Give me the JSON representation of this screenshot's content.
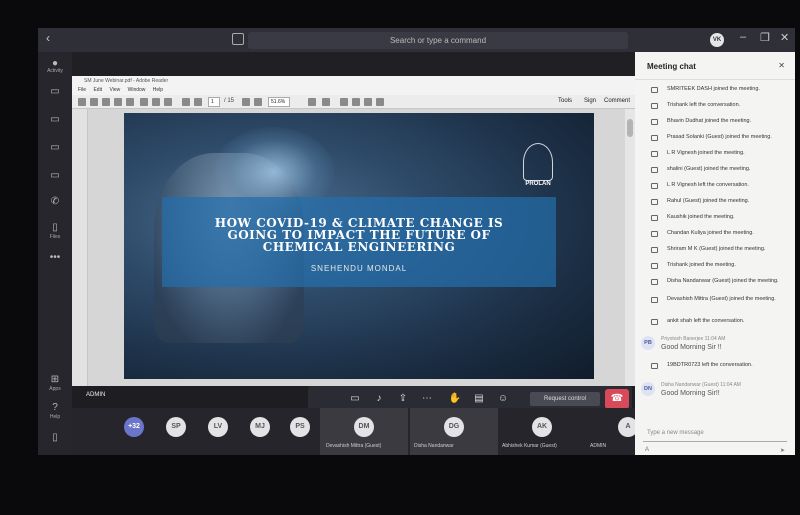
{
  "topbar": {
    "search_placeholder": "Search or type a command",
    "avatar_initials": "VK",
    "min": "–",
    "max": "❐",
    "close": "✕"
  },
  "rail": {
    "activity": "Activity",
    "apps": "Apps",
    "help": "Help",
    "files": "Files",
    "more": "•••"
  },
  "pdf": {
    "window_title": "SM June Webinar.pdf - Adobe Reader",
    "menu": [
      "File",
      "Edit",
      "View",
      "Window",
      "Help"
    ],
    "page_current": "1",
    "page_total": "/ 15",
    "zoom": "51.6%",
    "tools_right": [
      "Tools",
      "Sign",
      "Comment"
    ]
  },
  "slide": {
    "title_line1": "HOW COVID-19 & CLIMATE CHANGE IS",
    "title_line2": "GOING TO IMPACT THE FUTURE OF",
    "title_line3": "CHEMICAL ENGINEERING",
    "author": "SNEHENDU MONDAL",
    "logo_text": "PROLAN"
  },
  "stage": {
    "admin_label": "ADMIN",
    "request_control": "Request control"
  },
  "people": [
    {
      "initials": "+32",
      "name": ""
    },
    {
      "initials": "SP",
      "name": ""
    },
    {
      "initials": "LV",
      "name": ""
    },
    {
      "initials": "MJ",
      "name": ""
    },
    {
      "initials": "PS",
      "name": ""
    },
    {
      "initials": "DM",
      "name": "Devashish Mittra (Guest)"
    },
    {
      "initials": "DG",
      "name": "Disha Nandanwar"
    },
    {
      "initials": "AK",
      "name": "Abhishek Kumar (Guest)"
    },
    {
      "initials": "A",
      "name": "ADMIN"
    }
  ],
  "chat": {
    "title": "Meeting chat",
    "events": [
      "SMRITEEK DASH joined the meeting.",
      "Trishank left the conversation.",
      "Bhavin Dudhat joined the meeting.",
      "Prasad Solanki (Guest) joined the meeting.",
      "L R Vignesh joined the meeting.",
      "shalini (Guest) joined the meeting.",
      "L R Vignesh left the conversation.",
      "Rahul (Guest) joined the meeting.",
      "Kaushik joined the meeting.",
      "Chandan Kuliya joined the meeting.",
      "Shriram M K (Guest) joined the meeting.",
      "Trishank joined the meeting.",
      "Disha Nandanwar (Guest) joined the meeting.",
      "Devashish Mittra (Guest) joined the meeting.",
      "ankit shah left the conversation."
    ],
    "messages": [
      {
        "initials": "PB",
        "meta": "Priyotosh Banerjee   11:04 AM",
        "body": "Good Morning Sir !!"
      },
      {
        "initials": "DN",
        "meta": "Disha Nandanwar (Guest)   11:04 AM",
        "body": "Good Morning Sir!!"
      }
    ],
    "event_mid": "19BDTR0723 left the conversation.",
    "input_placeholder": "Type a new message"
  }
}
